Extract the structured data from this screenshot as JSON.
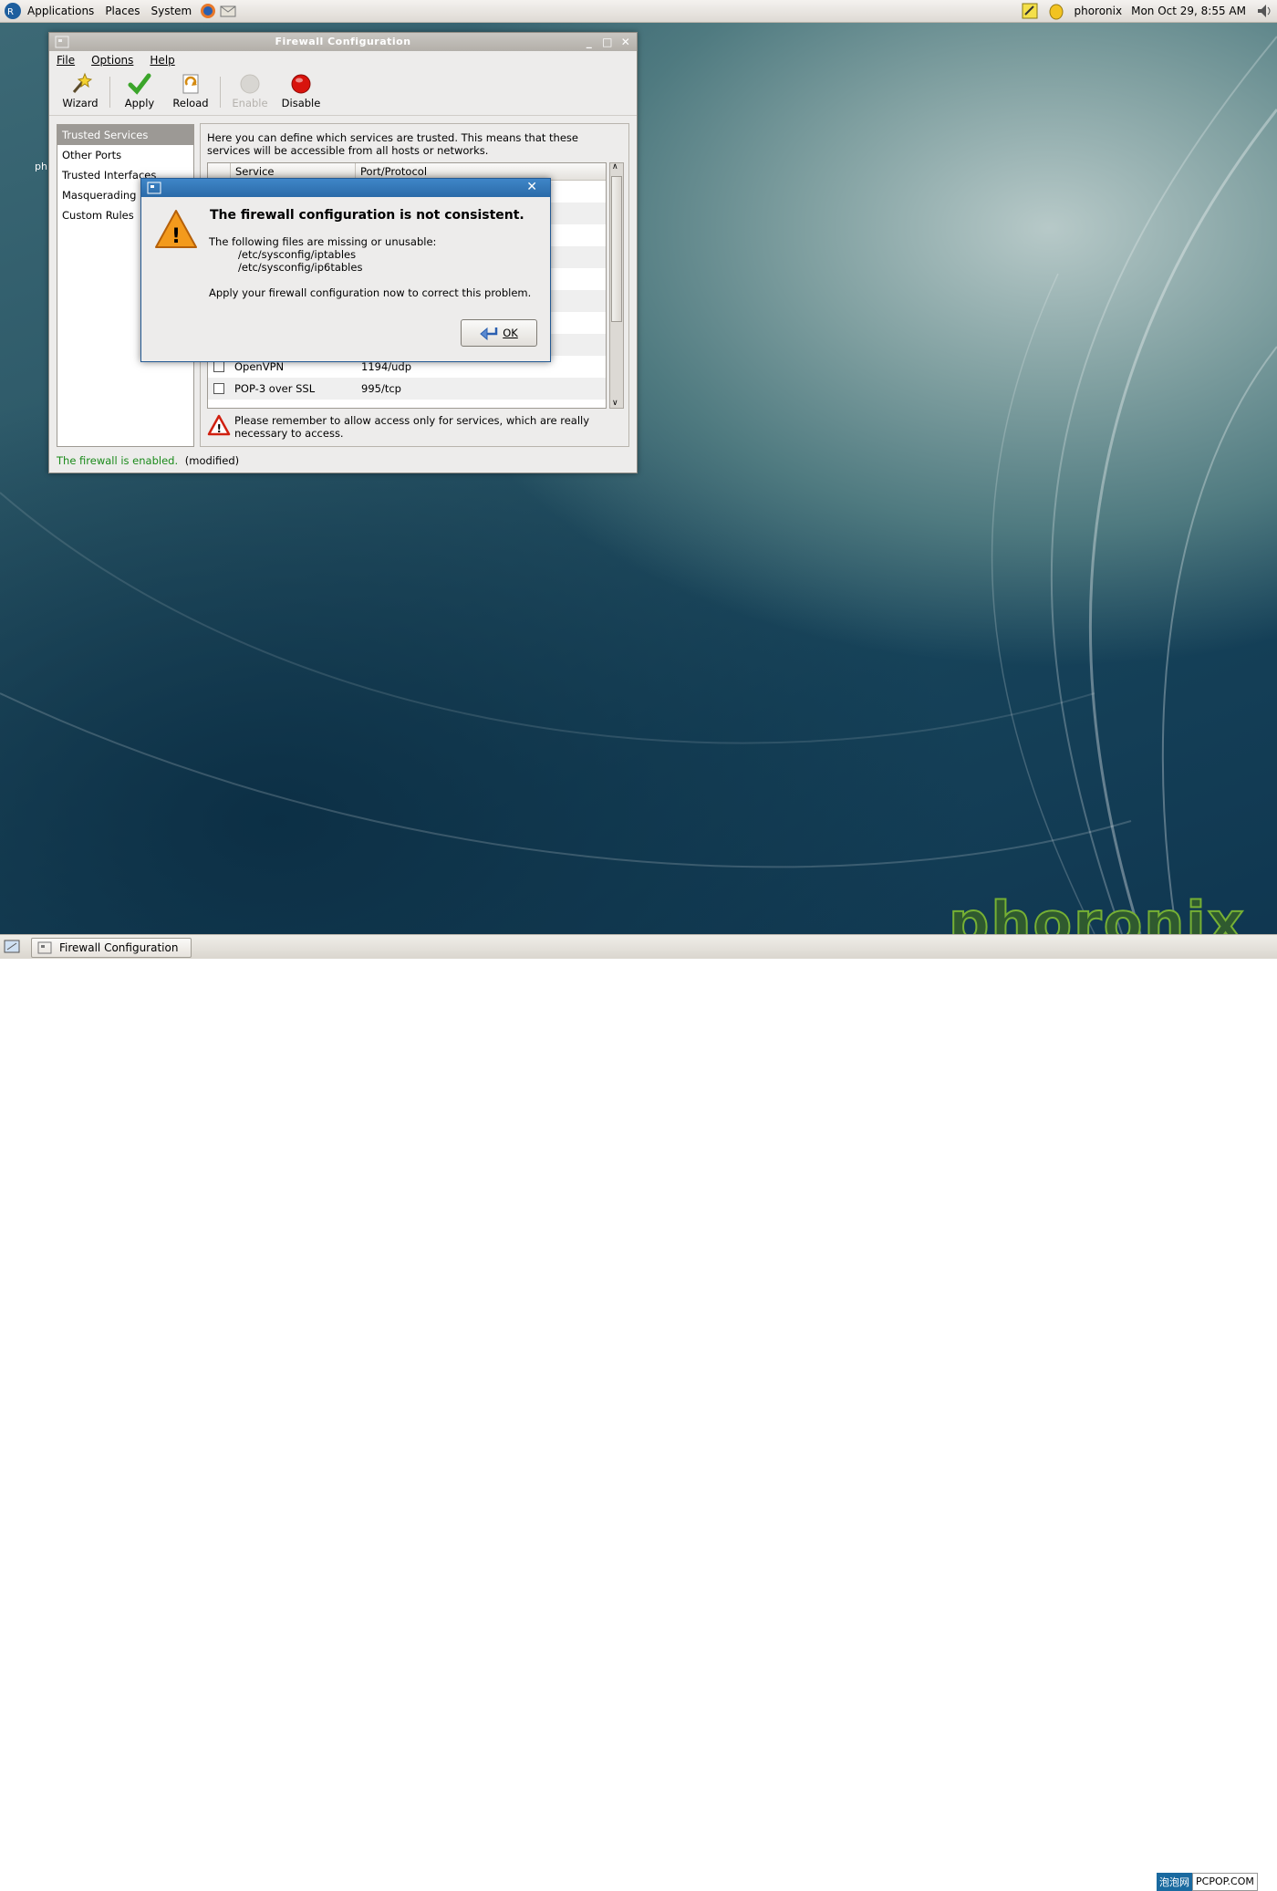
{
  "top_panel": {
    "menus": [
      "Applications",
      "Places",
      "System"
    ],
    "user": "phoronix",
    "clock": "Mon Oct 29,  8:55 AM"
  },
  "main_window": {
    "title": "Firewall Configuration",
    "menu": [
      "File",
      "Options",
      "Help"
    ],
    "toolbar": {
      "wizard": "Wizard",
      "apply": "Apply",
      "reload": "Reload",
      "enable": "Enable",
      "disable": "Disable"
    },
    "sidebar": [
      "Trusted Services",
      "Other Ports",
      "Trusted Interfaces",
      "Masquerading",
      "Custom Rules"
    ],
    "description": "Here you can define which services are trusted. This means that these services will be accessible from all hosts or networks.",
    "table": {
      "headers": [
        "Service",
        "Port/Protocol"
      ],
      "rows": [
        {
          "service": "OpenVPN",
          "port": "1194/udp"
        },
        {
          "service": "POP-3 over SSL",
          "port": "995/tcp"
        }
      ]
    },
    "note": "Please remember to allow access only for services, which are really necessary to access.",
    "status": {
      "enabled": "The firewall is enabled.",
      "modified": "(modified)"
    }
  },
  "dialog": {
    "heading": "The firewall configuration is not consistent.",
    "line1": "The following files are missing or unusable:",
    "file1": "/etc/sysconfig/iptables",
    "file2": "/etc/sysconfig/ip6tables",
    "line2": "Apply your firewall configuration now to correct this problem.",
    "ok": "OK"
  },
  "desktop": {
    "icon_label_fragment": "ph"
  },
  "taskbar": {
    "item": "Firewall Configuration"
  },
  "branding": {
    "logo": "phoronix",
    "badge1": "泡泡网",
    "badge2": "PCPOP.COM"
  }
}
